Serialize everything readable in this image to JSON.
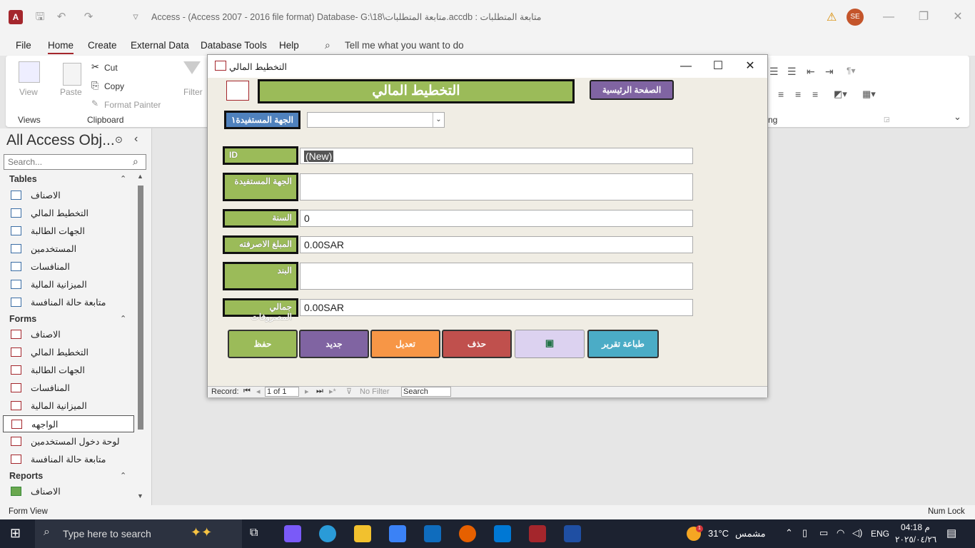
{
  "window": {
    "title": "Access - (Access 2007 - 2016 file format) Database- G:\\18\\متابعة المتطلبات.accdb : متابعة المتطلبات",
    "user_initials": "SE"
  },
  "menu": [
    "File",
    "Home",
    "Create",
    "External Data",
    "Database Tools",
    "Help"
  ],
  "tell_me": "Tell me what you want to do",
  "ribbon": {
    "view": "View",
    "views_group": "Views",
    "paste": "Paste",
    "cut": "Cut",
    "copy": "Copy",
    "format_painter": "Format Painter",
    "clipboard_group": "Clipboard",
    "filter": "Filter",
    "text_formatting_group": "ng"
  },
  "nav": {
    "title": "All Access Obj...",
    "search_placeholder": "Search...",
    "sections": {
      "tables": "Tables",
      "forms": "Forms",
      "reports": "Reports"
    },
    "tables": [
      "الاصناف",
      "التخطيط المالي",
      "الجهات الطالبة",
      "المستخدمين",
      "المنافسات",
      "الميزانية المالية",
      "متابعة حالة المنافسة"
    ],
    "forms": [
      "الاصناف",
      "التخطيط المالي",
      "الجهات الطالبة",
      "المنافسات",
      "الميزانية المالية",
      "الواجهه",
      "لوحة دخول المستخدمين",
      "متابعة حالة المنافسة"
    ],
    "reports": [
      "الاصناف"
    ]
  },
  "form": {
    "window_title": "التخطيط المالي",
    "header_title": "التخطيط المالي",
    "home_button": "الصفحة الرئيسية",
    "beneficiary_filter_label": "الجهة المستفيدة١",
    "fields": {
      "id_label": "ID",
      "id_value": "(New)",
      "beneficiary_label": "الجهة المستفيدة",
      "beneficiary_value": "",
      "year_label": "السنة",
      "year_value": "0",
      "amount_label": "المبلغ الاصرفته",
      "amount_value": "0.00SAR",
      "item_label": "البند",
      "item_value": "",
      "total_label": "جمالي المصروفات",
      "total_value": "0.00SAR"
    },
    "buttons": {
      "save": "حفظ",
      "new": "جديد",
      "edit": "تعديل",
      "delete": "حذف",
      "print": "طباعة تقرير"
    },
    "record_nav": {
      "record_label": "Record:",
      "position": "1 of 1",
      "no_filter": "No Filter",
      "search": "Search"
    }
  },
  "status": {
    "mode": "Form View",
    "num_lock": "Num Lock"
  },
  "taskbar": {
    "search_placeholder": "Type here to search",
    "temperature": "31°C",
    "weather": "مشمس",
    "language": "ENG",
    "time": "04:18 م",
    "date": "٢٠٢٥/٠٤/٢٦",
    "weather_badge": "1"
  },
  "colors": {
    "access_red": "#a4262c",
    "label_green": "#9bbb59",
    "save_green": "#9bbb59",
    "new_purple": "#8064a2",
    "edit_orange": "#f79646",
    "delete_red": "#c0504d",
    "print_blue": "#4bacc6",
    "excel_lavender": "#dcd2f0"
  }
}
